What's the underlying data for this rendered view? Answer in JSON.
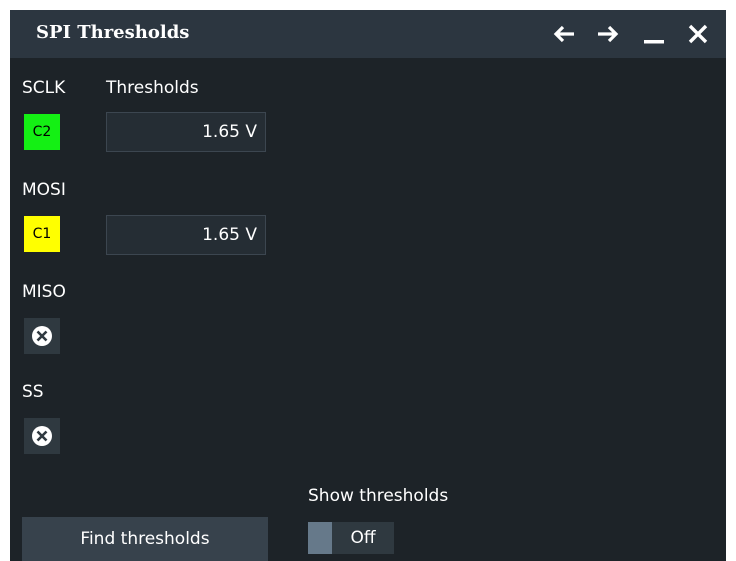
{
  "window": {
    "title": "SPI Thresholds"
  },
  "titlebar_icons": {
    "back": "arrow-left-icon",
    "forward": "arrow-right-icon",
    "minimize": "minimize-icon",
    "close": "close-icon"
  },
  "columns": {
    "thresholds_header": "Thresholds"
  },
  "channels": {
    "sclk": {
      "label": "SCLK",
      "source": "C2",
      "source_color": "#14f014",
      "threshold": "1.65 V"
    },
    "mosi": {
      "label": "MOSI",
      "source": "C1",
      "source_color": "#ffff00",
      "threshold": "1.65 V"
    },
    "miso": {
      "label": "MISO",
      "source_icon": "disabled-x-circle-icon"
    },
    "ss": {
      "label": "SS",
      "source_icon": "disabled-x-circle-icon"
    }
  },
  "actions": {
    "find_thresholds_label": "Find thresholds",
    "show_thresholds_label": "Show thresholds",
    "show_thresholds_state": "Off"
  },
  "colors": {
    "background": "#1d2328",
    "titlebar": "#2c3640",
    "button": "#37424c"
  }
}
